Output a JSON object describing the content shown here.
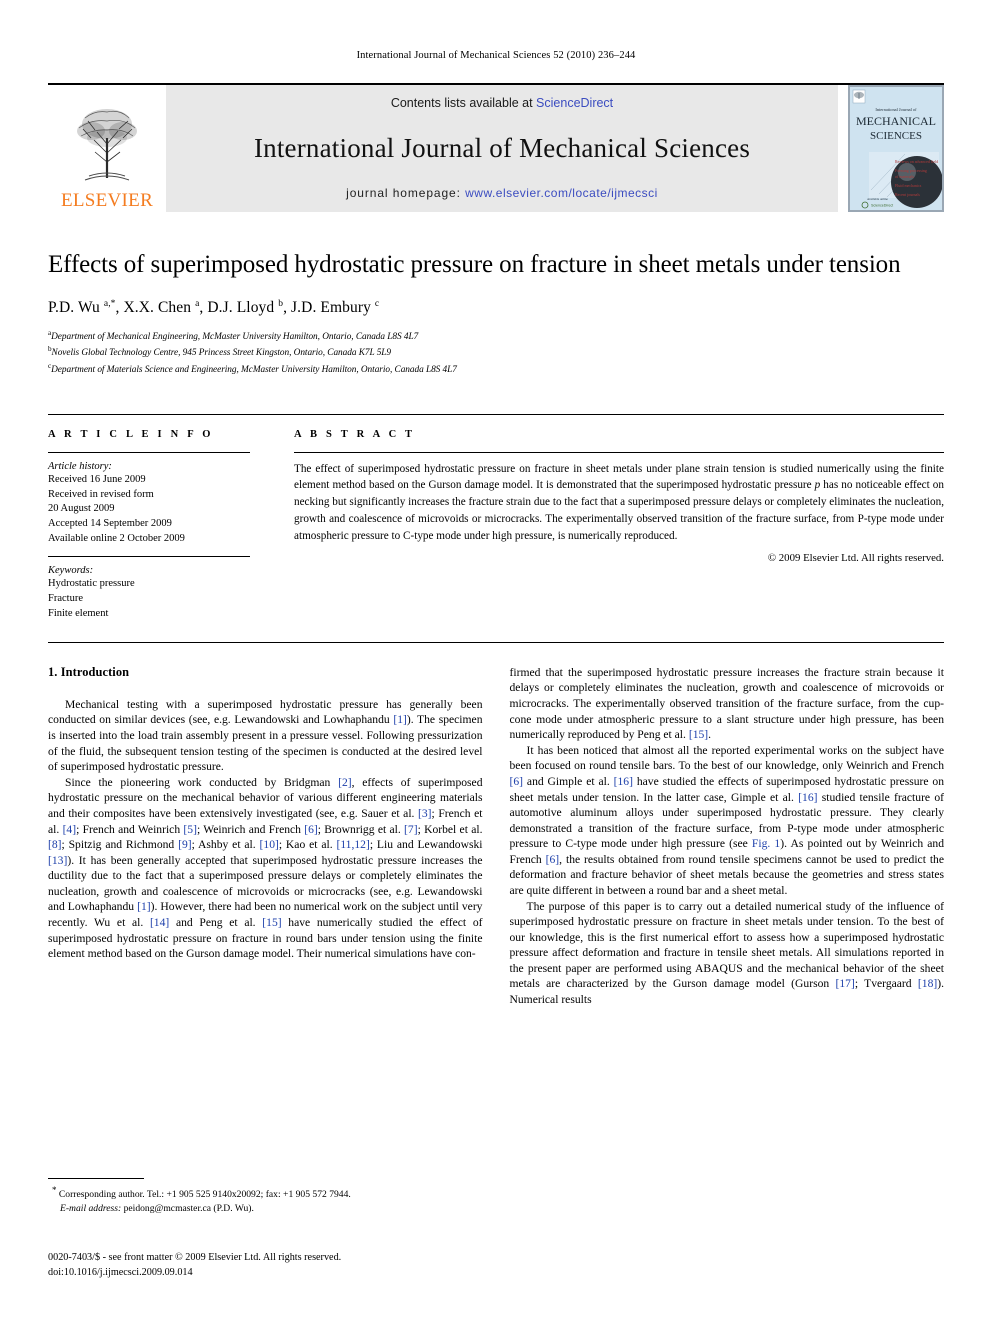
{
  "running_head": "International Journal of Mechanical Sciences 52 (2010) 236–244",
  "masthead": {
    "publisher_name": "ELSEVIER",
    "contents_prefix": "Contents lists available at ",
    "contents_link": "ScienceDirect",
    "journal_title": "International Journal of Mechanical Sciences",
    "homepage_prefix": "journal homepage: ",
    "homepage_url": "www.elsevier.com/locate/ijmecsci",
    "cover": {
      "line1": "International Journal of",
      "line2": "MECHANICAL",
      "line3": "SCIENCES",
      "item1": "Reviews on advanced field",
      "item2": "Forming processing of materials",
      "item3": "Fluid mechanics",
      "item4": "Recent journals",
      "footer": "Available online",
      "footer2": "ScienceDirect"
    },
    "link_color": "#3b4cc0",
    "elsevier_orange": "#F47C20"
  },
  "article": {
    "title": "Effects of superimposed hydrostatic pressure on fracture in sheet metals under tension",
    "authors_html": "P.D. Wu <sup>a,</sup><sup>*</sup>, X.X. Chen <sup>a</sup>, D.J. Lloyd <sup>b</sup>, J.D. Embury <sup>c</sup>",
    "affiliations": [
      {
        "marker": "a",
        "text": "Department of Mechanical Engineering, McMaster University Hamilton, Ontario, Canada L8S 4L7"
      },
      {
        "marker": "b",
        "text": "Novelis Global Technology Centre, 945 Princess Street Kingston, Ontario, Canada K7L 5L9"
      },
      {
        "marker": "c",
        "text": "Department of Materials Science and Engineering, McMaster University Hamilton, Ontario, Canada L8S 4L7"
      }
    ]
  },
  "article_info": {
    "label": "A R T I C L E   I N F O",
    "history_title": "Article history:",
    "history": [
      "Received 16 June 2009",
      "Received in revised form",
      "20 August 2009",
      "Accepted 14 September 2009",
      "Available online 2 October 2009"
    ],
    "keywords_title": "Keywords:",
    "keywords": [
      "Hydrostatic pressure",
      "Fracture",
      "Finite element"
    ]
  },
  "abstract": {
    "label": "A B S T R A C T",
    "text_part1": "The effect of superimposed hydrostatic pressure on fracture in sheet metals under plane strain tension is studied numerically using the finite element method based on the Gurson damage model. It is demonstrated that the superimposed hydrostatic pressure ",
    "italic_p": "p",
    "text_part2": " has no noticeable effect on necking but significantly increases the fracture strain due to the fact that a superimposed pressure delays or completely eliminates the nucleation, growth and coalescence of microvoids or microcracks. The experimentally observed transition of the fracture surface, from P-type mode under atmospheric pressure to C-type mode under high pressure, is numerically reproduced.",
    "copyright": "© 2009 Elsevier Ltd. All rights reserved."
  },
  "body": {
    "section1_heading": "1.  Introduction",
    "left_paragraphs": [
      "Mechanical testing with a superimposed hydrostatic pressure has generally been conducted on similar devices (see, e.g. Lewandowski and Lowhaphandu <a class=\"ref\">[1]</a>). The specimen is inserted into the load train assembly present in a pressure vessel. Following pressurization of the fluid, the subsequent tension testing of the specimen is conducted at the desired level of superimposed hydrostatic pressure.",
      "Since the pioneering work conducted by Bridgman <a class=\"ref\">[2]</a>, effects of superimposed hydrostatic pressure on the mechanical behavior of various different engineering materials and their composites have been extensively investigated (see, e.g. Sauer et al. <a class=\"ref\">[3]</a>; French et al. <a class=\"ref\">[4]</a>; French and Weinrich <a class=\"ref\">[5]</a>; Weinrich and French <a class=\"ref\">[6]</a>; Brownrigg et al. <a class=\"ref\">[7]</a>; Korbel et al. <a class=\"ref\">[8]</a>; Spitzig and Richmond <a class=\"ref\">[9]</a>; Ashby et al. <a class=\"ref\">[10]</a>; Kao et al. <a class=\"ref\">[11,12]</a>; Liu and Lewandowski <a class=\"ref\">[13]</a>). It has been generally accepted that superimposed hydrostatic pressure increases the ductility due to the fact that a superimposed pressure delays or completely eliminates the nucleation, growth and coalescence of microvoids or microcracks (see, e.g. Lewandowski and Lowhaphandu <a class=\"ref\">[1]</a>). However, there had been no numerical work on the subject until very recently. Wu et al. <a class=\"ref\">[14]</a> and Peng et al. <a class=\"ref\">[15]</a> have numerically studied the effect of superimposed hydrostatic pressure on fracture in round bars under tension using the finite element method based on the Gurson damage model. Their numerical simulations have con-"
    ],
    "right_paragraphs": [
      "firmed that the superimposed hydrostatic pressure increases the fracture strain because it delays or completely eliminates the nucleation, growth and coalescence of microvoids or microcracks. The experimentally observed transition of the fracture surface, from the cup-cone mode under atmospheric pressure to a slant structure under high pressure, has been numerically reproduced by Peng et al. <a class=\"ref\">[15]</a>.",
      "It has been noticed that almost all the reported experimental works on the subject have been focused on round tensile bars. To the best of our knowledge, only Weinrich and French <a class=\"ref\">[6]</a> and Gimple et al. <a class=\"ref\">[16]</a> have studied the effects of superimposed hydrostatic pressure on sheet metals under tension. In the latter case, Gimple et al. <a class=\"ref\">[16]</a> studied tensile fracture of automotive aluminum alloys under superimposed hydrostatic pressure. They clearly demonstrated a transition of the fracture surface, from P-type mode under atmospheric pressure to C-type mode under high pressure (see <a class=\"ref\">Fig. 1</a>). As pointed out by Weinrich and French <a class=\"ref\">[6]</a>, the results obtained from round tensile specimens cannot be used to predict the deformation and fracture behavior of sheet metals because the geometries and stress states are quite different in between a round bar and a sheet metal.",
      "The purpose of this paper is to carry out a detailed numerical study of the influence of superimposed hydrostatic pressure on fracture in sheet metals under tension. To the best of our knowledge, this is the first numerical effort to assess how a superimposed hydrostatic pressure affect deformation and fracture in tensile sheet metals. All simulations reported in the present paper are performed using ABAQUS and the mechanical behavior of the sheet metals are characterized by the Gurson damage model (Gurson <a class=\"ref\">[17]</a>; Tvergaard <a class=\"ref\">[18]</a>). Numerical results"
    ]
  },
  "footnote": {
    "star": "*",
    "corresponding": " Corresponding author. Tel.: +1 905 525 9140x20092; fax: +1 905 572 7944.",
    "email_label": "E-mail address:",
    "email": " peidong@mcmaster.ca (P.D. Wu)."
  },
  "imprint": {
    "line1": "0020-7403/$ - see front matter © 2009 Elsevier Ltd. All rights reserved.",
    "line2": "doi:10.1016/j.ijmecsci.2009.09.014"
  }
}
